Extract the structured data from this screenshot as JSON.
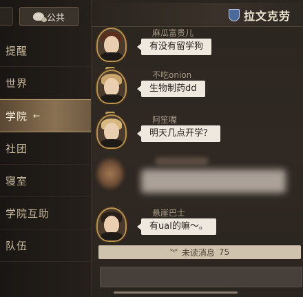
{
  "tabs": {
    "public_label": "公共",
    "icon": "chat-bubbles-icon"
  },
  "nav": {
    "items": [
      {
        "label": "提醒"
      },
      {
        "label": "世界"
      },
      {
        "label": "学院",
        "active": true,
        "arrow": "←"
      },
      {
        "label": "社团"
      },
      {
        "label": "寝室"
      },
      {
        "label": "学院互助"
      },
      {
        "label": "队伍"
      }
    ]
  },
  "header": {
    "title": "拉文克劳",
    "crest_icon": "ravenclaw-crest-icon",
    "accent": "#4a6a9a"
  },
  "messages": [
    {
      "sender": "麻瓜富贵儿",
      "text": "有没有留学狗"
    },
    {
      "sender": "不吃onion",
      "text": "生物制药dd"
    },
    {
      "sender": "阿笙喔",
      "text": "明天几点开学？"
    },
    {
      "sender": "",
      "text": ""
    },
    {
      "sender": "悬崖巴士",
      "text": "有ual的嘛～。"
    }
  ],
  "unread": {
    "label": "未读消息",
    "count": "75"
  },
  "colors": {
    "active_nav": "#8a7152",
    "bubble": "#eee8de",
    "unread_bar": "#cfc3ad"
  }
}
